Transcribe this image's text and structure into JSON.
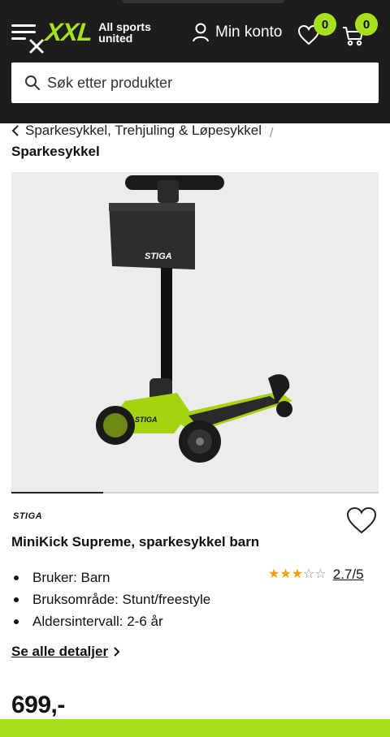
{
  "header": {
    "logo_text": "XXL",
    "tagline_line1": "All sports",
    "tagline_line2": "united",
    "account_label": "Min konto",
    "wishlist_count": "0",
    "cart_count": "0",
    "search_placeholder": "Søk etter produkter"
  },
  "breadcrumb": {
    "parent": "Sparkesykkel, Trehjuling & Løpesykkel",
    "separator": "/",
    "current": "Sparkesykkel"
  },
  "product": {
    "image_brand_mark": "STIGA",
    "gallery_progress": 0.25,
    "brand": "STIGA",
    "title": "MiniKick Supreme, sparkesykkel barn",
    "specs": [
      "Bruker: Barn",
      "Bruksområde: Stunt/freestyle",
      "Aldersintervall: 2-6 år"
    ],
    "rating": 2.7,
    "rating_text": "2.7/5",
    "details_link": "Se alle detaljer",
    "price": "699,-"
  },
  "colors": {
    "brand_green": "#a7e01d",
    "header_bg": "#1d1d1d",
    "star": "#f2a200"
  }
}
